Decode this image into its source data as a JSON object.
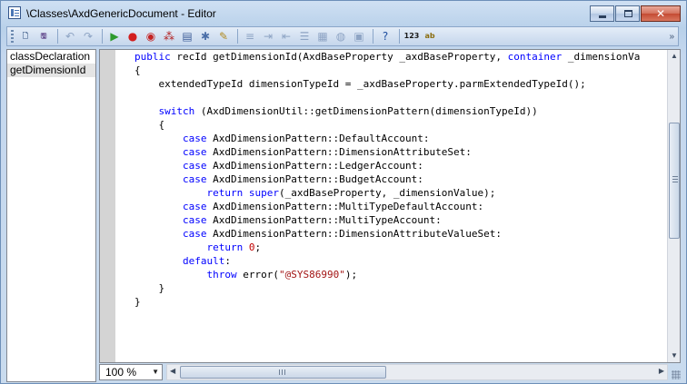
{
  "window": {
    "title": "\\Classes\\AxdGenericDocument - Editor",
    "minimize_label": "minimize",
    "maximize_label": "maximize",
    "close_label": "close"
  },
  "toolbar": {
    "buttons": [
      {
        "icon": "new-document-icon",
        "glyph": "🗋",
        "color": "#3b5a86"
      },
      {
        "icon": "save-icon",
        "glyph": "🖫",
        "color": "#5a3f86"
      },
      {
        "icon": "undo-icon",
        "glyph": "↶",
        "color": "#8ea4c4"
      },
      {
        "icon": "redo-icon",
        "glyph": "↷",
        "color": "#8ea4c4"
      },
      {
        "icon": "run-icon",
        "glyph": "▶",
        "color": "#2d9a2d"
      },
      {
        "icon": "breakpoint-icon",
        "glyph": "●",
        "color": "#d21f1f"
      },
      {
        "icon": "enable-breakpoint-icon",
        "glyph": "◉",
        "color": "#c42222"
      },
      {
        "icon": "breakpoints-list-icon",
        "glyph": "⁂",
        "color": "#b32020"
      },
      {
        "icon": "compile-icon",
        "glyph": "▤",
        "color": "#3f5f99"
      },
      {
        "icon": "lookup-icon",
        "glyph": "✱",
        "color": "#4b6fa8"
      },
      {
        "icon": "script-icon",
        "glyph": "✎",
        "color": "#b08a1f"
      },
      {
        "icon": "insert-line-icon",
        "glyph": "≡",
        "color": "#8ea4c4"
      },
      {
        "icon": "indent-icon",
        "glyph": "⇥",
        "color": "#8ea4c4"
      },
      {
        "icon": "outdent-icon",
        "glyph": "⇤",
        "color": "#8ea4c4"
      },
      {
        "icon": "list-members-icon",
        "glyph": "☰",
        "color": "#8ea4c4"
      },
      {
        "icon": "list-tables-icon",
        "glyph": "▦",
        "color": "#8ea4c4"
      },
      {
        "icon": "web-icon",
        "glyph": "◍",
        "color": "#8ea4c4"
      },
      {
        "icon": "properties-icon",
        "glyph": "▣",
        "color": "#8ea4c4"
      },
      {
        "icon": "help-icon",
        "glyph": "?",
        "color": "#1f4fa0"
      },
      {
        "icon": "label-editor-icon",
        "glyph": "123",
        "color": "#1a1a1a"
      },
      {
        "icon": "spell-check-icon",
        "glyph": "ab",
        "color": "#8a6d10"
      }
    ],
    "overflow_icon": "toolbar-overflow-icon",
    "overflow_glyph": "»"
  },
  "methods": {
    "items": [
      {
        "label": "classDeclaration",
        "selected": false
      },
      {
        "label": "getDimensionId",
        "selected": true
      }
    ]
  },
  "code": {
    "lines": [
      [
        {
          "t": "public ",
          "c": "kw"
        },
        {
          "t": "recId getDimensionId(AxdBaseProperty _axdBaseProperty, "
        },
        {
          "t": "container",
          "c": "kw"
        },
        {
          "t": " _dimensionVa"
        }
      ],
      [
        {
          "t": "{"
        }
      ],
      [
        {
          "t": "    extendedTypeId dimensionTypeId = _axdBaseProperty.parmExtendedTypeId();"
        }
      ],
      [
        {
          "t": ""
        }
      ],
      [
        {
          "t": "    "
        },
        {
          "t": "switch",
          "c": "kw"
        },
        {
          "t": " (AxdDimensionUtil::getDimensionPattern(dimensionTypeId))"
        }
      ],
      [
        {
          "t": "    {"
        }
      ],
      [
        {
          "t": "        "
        },
        {
          "t": "case",
          "c": "kw"
        },
        {
          "t": " AxdDimensionPattern::DefaultAccount:"
        }
      ],
      [
        {
          "t": "        "
        },
        {
          "t": "case",
          "c": "kw"
        },
        {
          "t": " AxdDimensionPattern::DimensionAttributeSet:"
        }
      ],
      [
        {
          "t": "        "
        },
        {
          "t": "case",
          "c": "kw"
        },
        {
          "t": " AxdDimensionPattern::LedgerAccount:"
        }
      ],
      [
        {
          "t": "        "
        },
        {
          "t": "case",
          "c": "kw"
        },
        {
          "t": " AxdDimensionPattern::BudgetAccount:"
        }
      ],
      [
        {
          "t": "            "
        },
        {
          "t": "return",
          "c": "kw"
        },
        {
          "t": " "
        },
        {
          "t": "super",
          "c": "kw"
        },
        {
          "t": "(_axdBaseProperty, _dimensionValue);"
        }
      ],
      [
        {
          "t": "        "
        },
        {
          "t": "case",
          "c": "kw"
        },
        {
          "t": " AxdDimensionPattern::MultiTypeDefaultAccount:"
        }
      ],
      [
        {
          "t": "        "
        },
        {
          "t": "case",
          "c": "kw"
        },
        {
          "t": " AxdDimensionPattern::MultiTypeAccount:"
        }
      ],
      [
        {
          "t": "        "
        },
        {
          "t": "case",
          "c": "kw"
        },
        {
          "t": " AxdDimensionPattern::DimensionAttributeValueSet:"
        }
      ],
      [
        {
          "t": "            "
        },
        {
          "t": "return",
          "c": "kw"
        },
        {
          "t": " "
        },
        {
          "t": "0",
          "c": "num"
        },
        {
          "t": ";"
        }
      ],
      [
        {
          "t": "        "
        },
        {
          "t": "default",
          "c": "kw"
        },
        {
          "t": ":"
        }
      ],
      [
        {
          "t": "            "
        },
        {
          "t": "throw",
          "c": "kw"
        },
        {
          "t": " error("
        },
        {
          "t": "\"@SYS86990\"",
          "c": "str"
        },
        {
          "t": ");"
        }
      ],
      [
        {
          "t": "    }"
        }
      ],
      [
        {
          "t": "}"
        }
      ]
    ]
  },
  "zoom": {
    "value": "100 %"
  },
  "scroll": {
    "vertical_position": 0.35,
    "horizontal_position": 0.0
  }
}
